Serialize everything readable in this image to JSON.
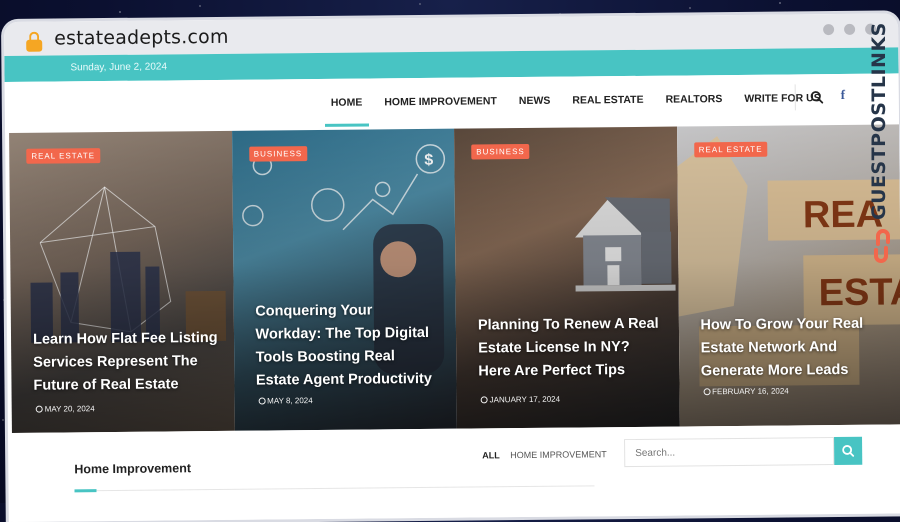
{
  "browser": {
    "url": "estateadepts.com",
    "lock_icon": "lock-icon",
    "window_controls": [
      "dot",
      "dot",
      "dot"
    ]
  },
  "topbar": {
    "date": "Sunday, June 2, 2024"
  },
  "nav": {
    "items": [
      {
        "label": "HOME",
        "active": true
      },
      {
        "label": "HOME IMPROVEMENT"
      },
      {
        "label": "NEWS"
      },
      {
        "label": "REAL ESTATE"
      },
      {
        "label": "REALTORS"
      },
      {
        "label": "WRITE FOR US"
      }
    ],
    "search_icon": "search-icon",
    "facebook_icon": "f"
  },
  "featured": [
    {
      "category": "REAL ESTATE",
      "title": "Learn How Flat Fee Listing Services Represent The Future of Real Estate",
      "date": "MAY 20, 2024"
    },
    {
      "category": "BUSINESS",
      "title": "Conquering Your Workday: The Top Digital Tools Boosting Real Estate Agent Productivity",
      "date": "MAY 8, 2024"
    },
    {
      "category": "BUSINESS",
      "title": "Planning To Renew A Real Estate License In NY? Here Are Perfect Tips",
      "date": "JANUARY 17, 2024"
    },
    {
      "category": "REAL ESTATE",
      "title": "How To Grow Your Real Estate Network And Generate More Leads",
      "date": "FEBRUARY 16, 2024"
    }
  ],
  "section": {
    "title": "Home Improvement",
    "filters": {
      "all": "ALL",
      "category": "HOME IMPROVEMENT"
    }
  },
  "sidebar_search": {
    "placeholder": "Search..."
  },
  "watermark": {
    "text": "GUESTPOSTLINKS"
  },
  "colors": {
    "accent": "#48c4c3",
    "badge": "#f2674c",
    "lock": "#f5a623"
  }
}
